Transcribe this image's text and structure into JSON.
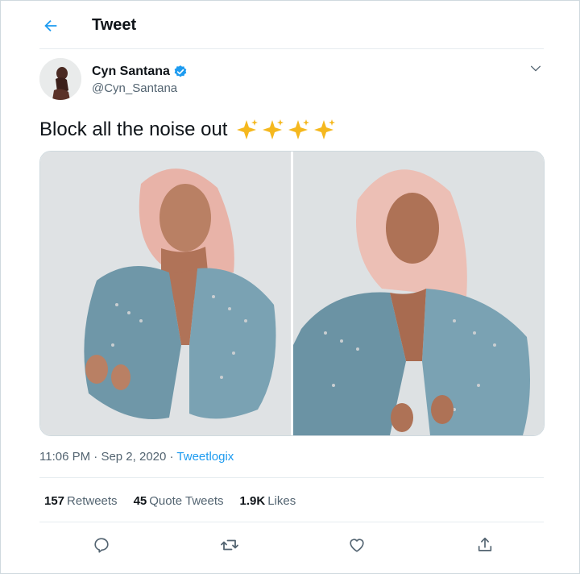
{
  "header": {
    "title": "Tweet"
  },
  "author": {
    "name": "Cyn Santana",
    "handle": "@Cyn_Santana",
    "verified": true
  },
  "tweet": {
    "text": "Block all the noise out",
    "emoji": "✨✨✨✨",
    "media_count": 2
  },
  "meta": {
    "time": "11:06 PM",
    "date": "Sep 2, 2020",
    "source": "Tweetlogix"
  },
  "stats": {
    "retweets_count": "157",
    "retweets_label": "Retweets",
    "quotes_count": "45",
    "quotes_label": "Quote Tweets",
    "likes_count": "1.9K",
    "likes_label": "Likes"
  },
  "colors": {
    "accent": "#1d9bf0",
    "text": "#0f1419",
    "secondary": "#536471",
    "border": "#e6ecf0"
  }
}
